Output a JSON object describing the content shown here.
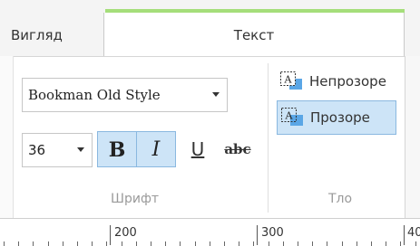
{
  "tabs": {
    "view_label": "Вигляд",
    "text_label": "Текст"
  },
  "font_group": {
    "font_family": "Bookman Old Style",
    "font_size": "36",
    "bold_label": "B",
    "italic_label": "I",
    "underline_label": "U",
    "strike_label": "abc",
    "group_label": "Шрифт"
  },
  "background_group": {
    "opaque_label": "Непрозоре",
    "transparent_label": "Прозоре",
    "group_label": "Тло"
  },
  "ruler": {
    "labels": [
      "200",
      "300",
      "40"
    ]
  },
  "colors": {
    "accent": "#a5de7a",
    "selected_bg": "#cde4f7",
    "selected_border": "#8ab8e0",
    "icon_blue": "#5aa6e6"
  }
}
